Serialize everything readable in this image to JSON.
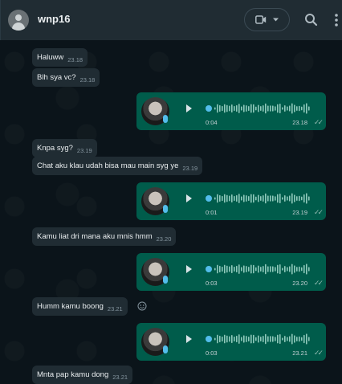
{
  "header": {
    "contact_name": "wnp16",
    "icons": [
      "default-avatar-icon",
      "video-camera-icon",
      "chevron-down-icon",
      "search-icon",
      "more-vertical-icon"
    ]
  },
  "messages": [
    {
      "type": "in",
      "text": "Haluww",
      "time": "23.18"
    },
    {
      "type": "in",
      "text": "Blh sya vc?",
      "time": "23.18"
    },
    {
      "type": "voice",
      "duration": "0:04",
      "time": "23.18"
    },
    {
      "type": "in",
      "text": "Knpa syg?",
      "time": "23.19"
    },
    {
      "type": "in",
      "text": "Chat aku klau udah bisa mau main syg ye",
      "time": "23.19"
    },
    {
      "type": "voice",
      "duration": "0:01",
      "time": "23.19"
    },
    {
      "type": "in",
      "text": "Kamu liat dri mana aku mnis hmm",
      "time": "23.20"
    },
    {
      "type": "voice",
      "duration": "0:03",
      "time": "23.20"
    },
    {
      "type": "in",
      "text": "Humm kamu boong",
      "time": "23.21"
    },
    {
      "type": "voice",
      "duration": "0:03",
      "time": "23.21"
    },
    {
      "type": "in",
      "text": "Mnta pap kamu dong",
      "time": "23.21"
    }
  ],
  "colors": {
    "header_bg": "#202c33",
    "chat_bg": "#0b141a",
    "incoming_bubble": "#202c33",
    "outgoing_bubble": "#005c4b",
    "accent": "#53bdeb"
  }
}
